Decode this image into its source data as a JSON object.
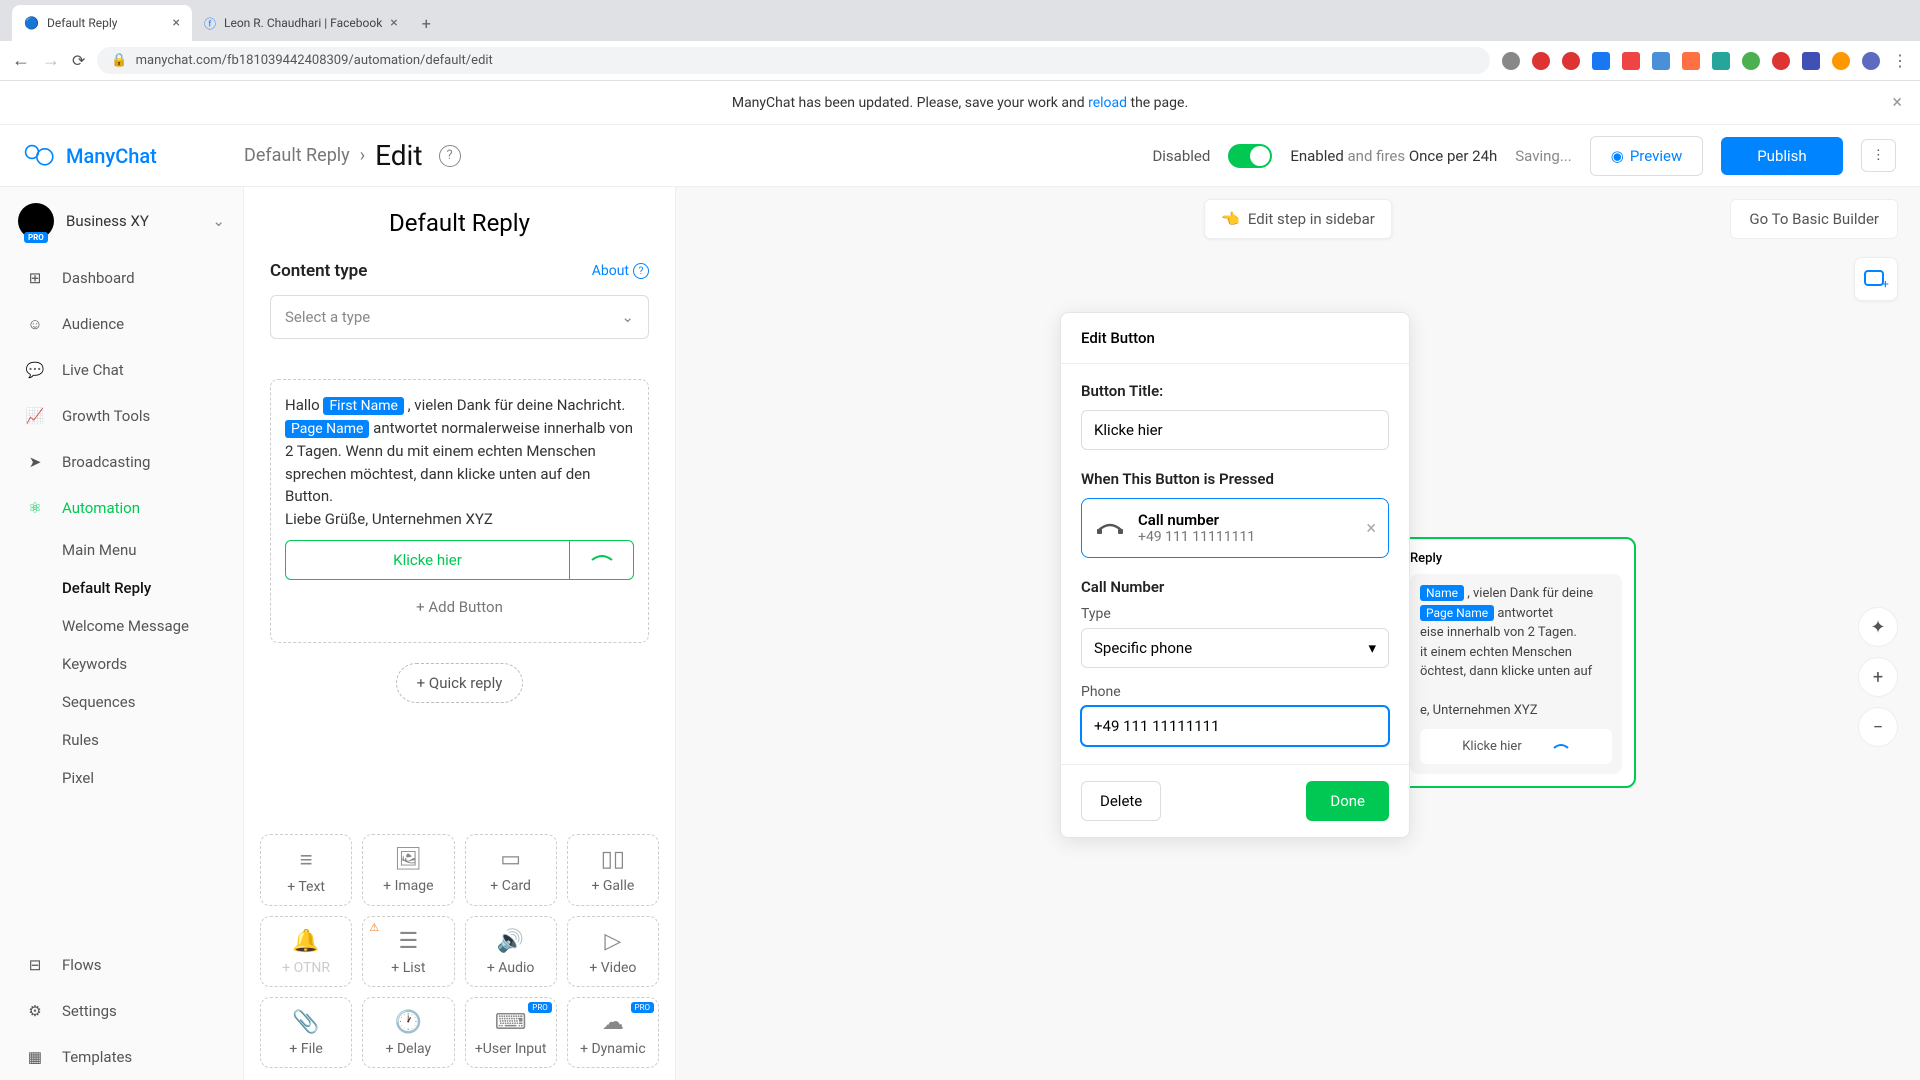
{
  "browser": {
    "tabs": [
      {
        "title": "Default Reply",
        "active": true
      },
      {
        "title": "Leon R. Chaudhari | Facebook",
        "active": false
      }
    ],
    "url": "manychat.com/fb181039442408309/automation/default/edit"
  },
  "notification": {
    "prefix": "ManyChat has been updated. Please, save your work and ",
    "link": "reload",
    "suffix": " the page."
  },
  "header": {
    "brand": "ManyChat",
    "breadcrumb": "Default Reply",
    "current": "Edit",
    "disabled": "Disabled",
    "enabled": "Enabled",
    "fires_grey": "and fires",
    "fires_bold": "Once per 24h",
    "saving": "Saving...",
    "preview": "Preview",
    "publish": "Publish"
  },
  "sidebar": {
    "account": "Business XY",
    "items": {
      "dashboard": "Dashboard",
      "audience": "Audience",
      "livechat": "Live Chat",
      "growth": "Growth Tools",
      "broadcasting": "Broadcasting",
      "automation": "Automation",
      "flows": "Flows",
      "settings": "Settings",
      "templates": "Templates"
    },
    "sub": {
      "mainmenu": "Main Menu",
      "defaultreply": "Default Reply",
      "welcome": "Welcome Message",
      "keywords": "Keywords",
      "sequences": "Sequences",
      "rules": "Rules",
      "pixel": "Pixel"
    }
  },
  "content": {
    "panel_title": "Default Reply",
    "content_type": "Content type",
    "about": "About",
    "select_type": "Select a type",
    "message": {
      "t1": "Hallo ",
      "var1": "First Name",
      "t2": " , vielen Dank für deine Nachricht. ",
      "var2": "Page Name",
      "t3": " antwortet normalerweise innerhalb von 2 Tagen. Wenn du mit einem echten Menschen sprechen möchtest, dann klicke unten auf den Button.",
      "t4": "Liebe Grüße, Unternehmen XYZ"
    },
    "button_label": "Klicke hier",
    "add_button": "+ Add Button",
    "quick_reply": "+ Quick reply"
  },
  "blocks": {
    "text": "+ Text",
    "image": "+ Image",
    "card": "+ Card",
    "gallery": "+ Galle",
    "otnr": "+ OTNR",
    "list": "+ List",
    "audio": "+ Audio",
    "video": "+ Video",
    "file": "+ File",
    "delay": "+ Delay",
    "userinput": "+User Input",
    "dynamic": "+ Dynamic",
    "pro": "PRO"
  },
  "canvas": {
    "edit_sidebar": "Edit step in sidebar",
    "basic_builder": "Go To Basic Builder"
  },
  "popover": {
    "header": "Edit Button",
    "title_label": "Button Title:",
    "title_value": "Klicke hier",
    "when_pressed": "When This Button is Pressed",
    "action_title": "Call number",
    "action_sub": "+49 111 11111111",
    "call_section": "Call Number",
    "type_label": "Type",
    "type_value": "Specific phone",
    "phone_label": "Phone",
    "phone_value": "+49 111 11111111",
    "delete": "Delete",
    "done": "Done"
  },
  "reply_node": {
    "header": "Reply",
    "l1a": "Name",
    "l1b": " , vielen Dank für deine",
    "l2a": "Page Name",
    "l2b": " antwortet",
    "l3": "eise innerhalb von 2 Tagen.",
    "l4": "it einem echten Menschen",
    "l5": "öchtest, dann klicke unten auf",
    "l6": "e, Unternehmen XYZ",
    "btn": "Klicke hier"
  }
}
